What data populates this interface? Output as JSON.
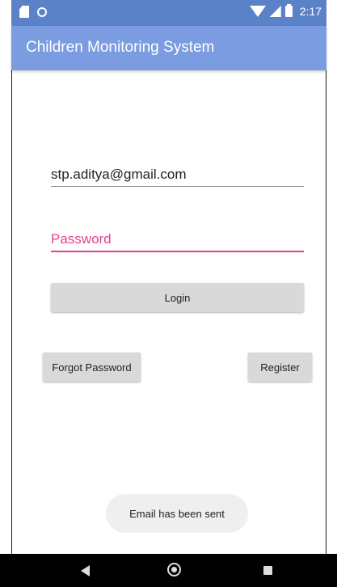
{
  "status_bar": {
    "time": "2:17",
    "icons": [
      "sd-card-icon",
      "circle-notification-icon",
      "wifi-icon",
      "cell-signal-icon",
      "battery-icon"
    ]
  },
  "app_bar": {
    "title": "Children Monitoring System"
  },
  "login_form": {
    "email_value": "stp.aditya@gmail.com",
    "password_placeholder": "Password",
    "login_label": "Login",
    "forgot_password_label": "Forgot Password",
    "register_label": "Register"
  },
  "toast": {
    "message": "Email has been sent"
  },
  "nav_bar": {
    "icons": [
      "back-icon",
      "home-icon",
      "recents-icon"
    ]
  },
  "colors": {
    "status_bar": "#5a82c9",
    "app_bar": "#7b9ce0",
    "accent": "#e8428c",
    "button": "#d9d9d9",
    "toast": "#efefef",
    "nav_bar": "#000000"
  }
}
